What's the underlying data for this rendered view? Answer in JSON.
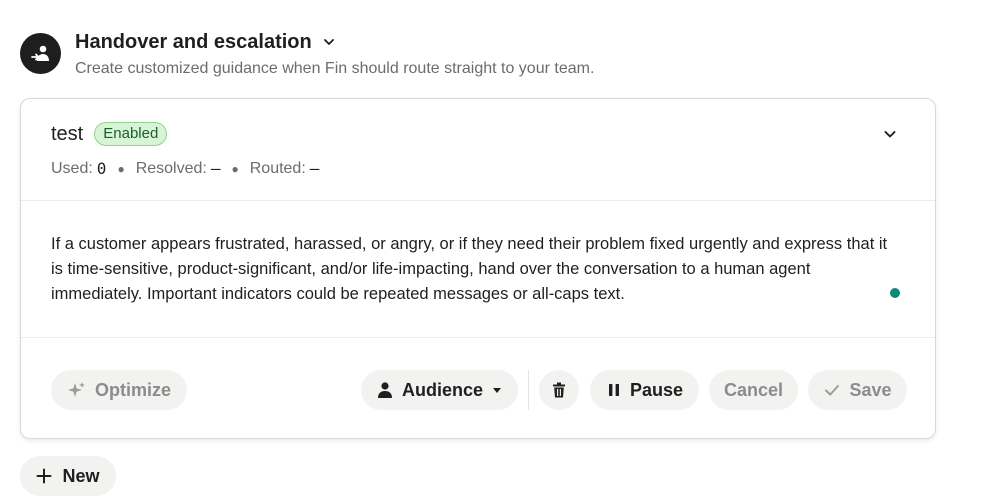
{
  "section": {
    "title": "Handover and escalation",
    "subtitle": "Create customized guidance when Fin should route straight to your team.",
    "icon": "handover-person-icon"
  },
  "rule": {
    "name": "test",
    "status_badge": "Enabled",
    "stats": {
      "used_label": "Used:",
      "used_value": "0",
      "resolved_label": "Resolved:",
      "resolved_value": "–",
      "routed_label": "Routed:",
      "routed_value": "–"
    },
    "guidance_text": "If a customer appears frustrated, harassed, or angry, or if they need their problem fixed urgently and express that it is time-sensitive, product-significant, and/or life-impacting, hand over the conversation to a human agent immediately. Important indicators could be repeated messages or all-caps text."
  },
  "actions": {
    "optimize_label": "Optimize",
    "audience_label": "Audience",
    "pause_label": "Pause",
    "cancel_label": "Cancel",
    "save_label": "Save"
  },
  "new_label": "New",
  "colors": {
    "enabled_bg": "#d7f5d6",
    "enabled_text": "#1d5e2c",
    "status_dot": "#0f8a78",
    "button_bg": "#f2f2f0"
  }
}
